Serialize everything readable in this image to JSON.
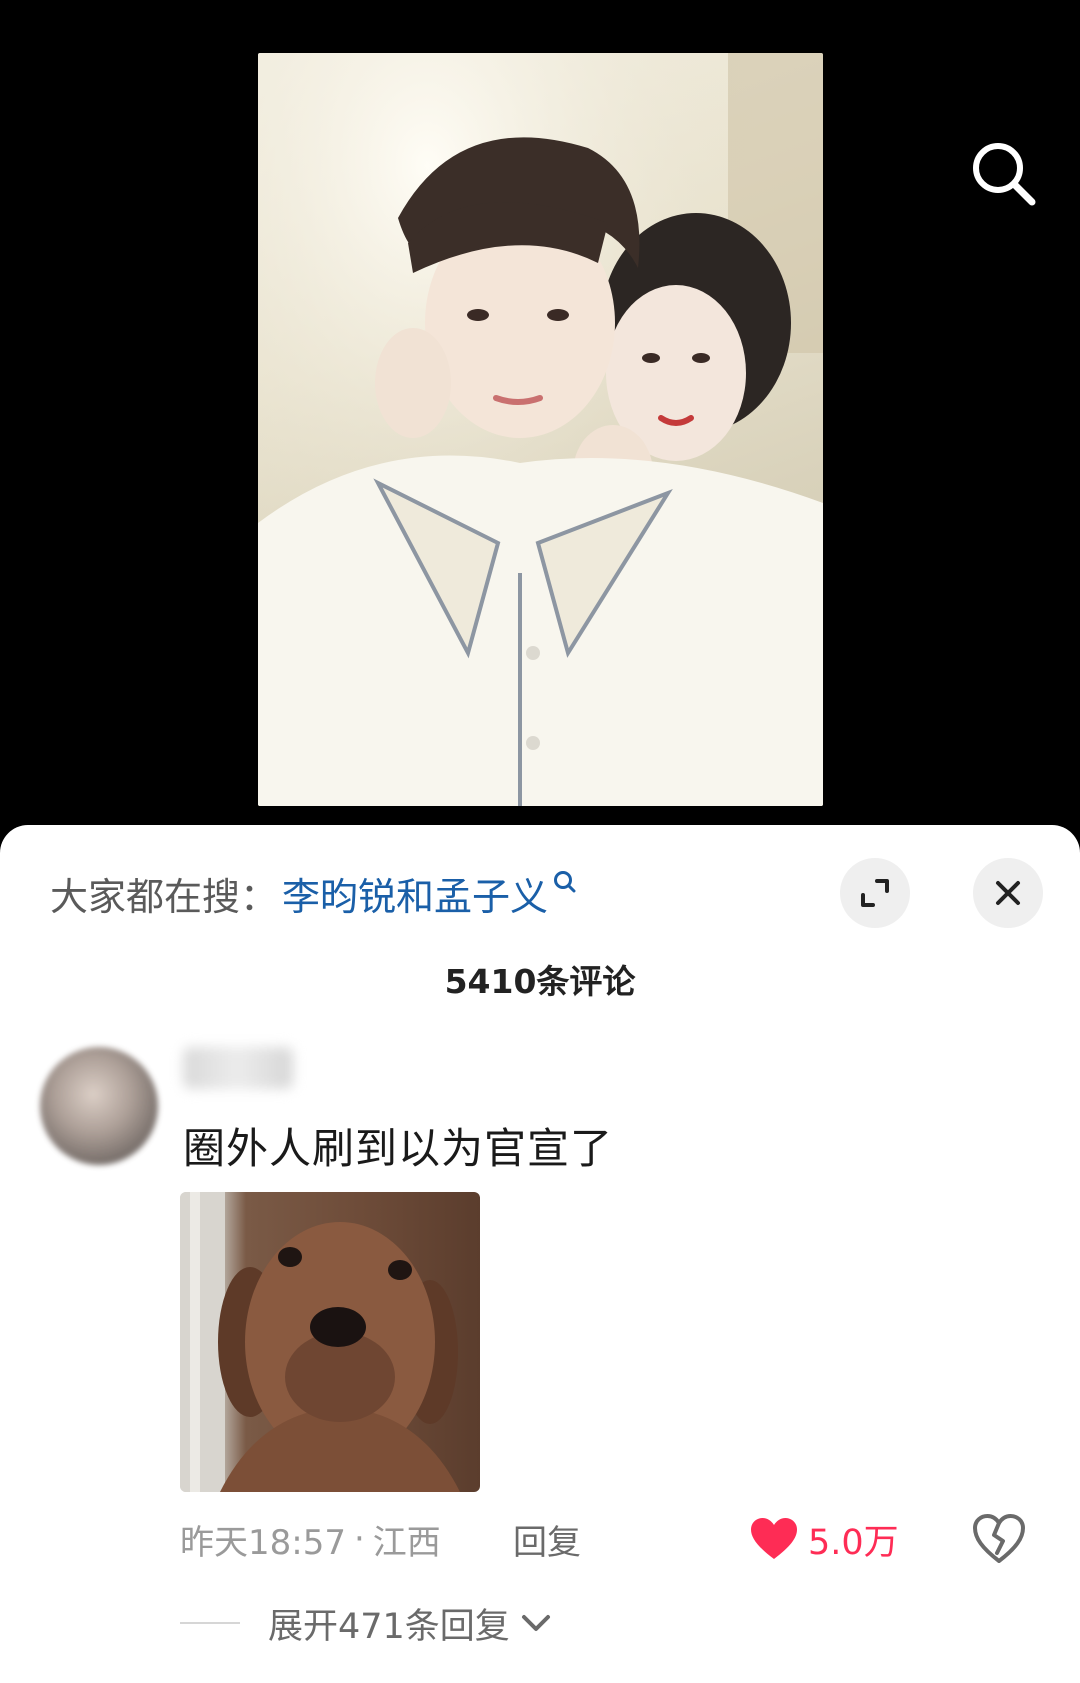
{
  "icons": {
    "search": "search-icon",
    "expand": "fullscreen-expand-icon",
    "close": "close-icon",
    "like": "heart-icon",
    "dislike": "broken-heart-icon",
    "chevron": "chevron-down-icon"
  },
  "colors": {
    "link": "#1a5fa8",
    "like": "#fe2c55",
    "muted": "#9a9a9a"
  },
  "sheet": {
    "search_prefix": "大家都在搜：",
    "search_keyword": "李昀锐和孟子义",
    "comment_count_title": "5410条评论"
  },
  "comment": {
    "username": "甘",
    "text": "圈外人刷到以为官宣了",
    "time": "昨天18:57",
    "separator": "·",
    "location": "江西",
    "reply_label": "回复",
    "like_count": "5.0万",
    "expand_replies_label": "展开471条回复"
  }
}
